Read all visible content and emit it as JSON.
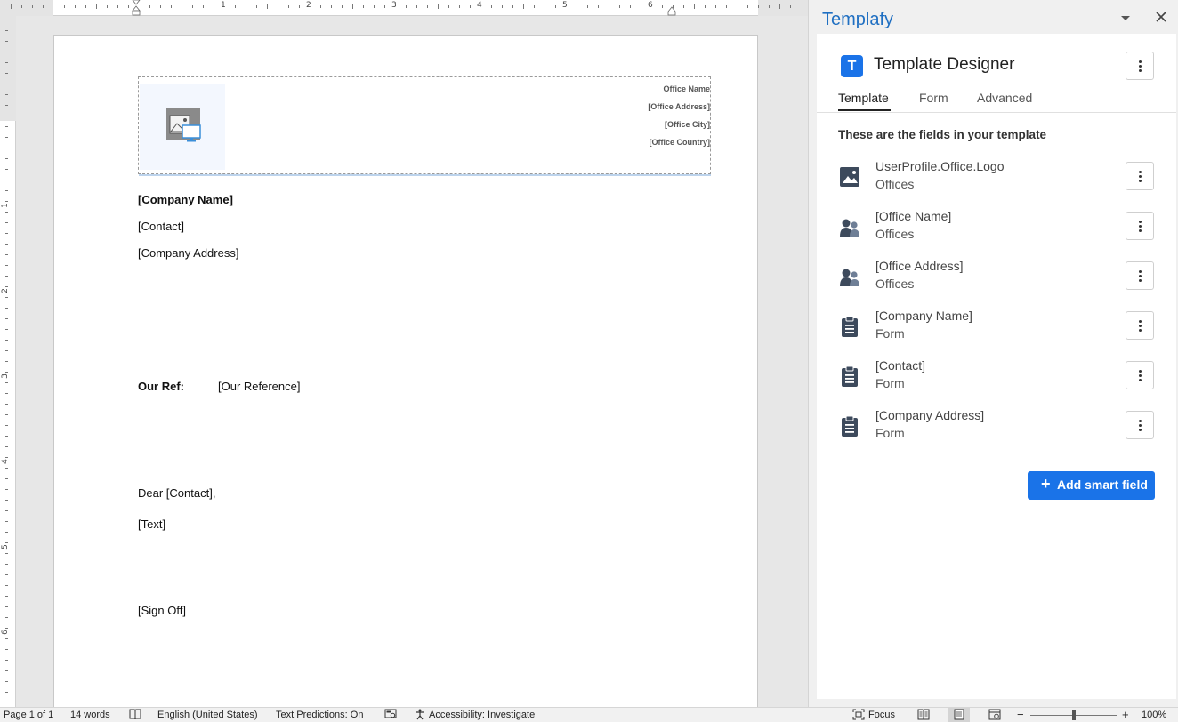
{
  "ruler": {
    "h_numbers": [
      "1",
      "2",
      "3",
      "4",
      "5",
      "6"
    ],
    "v_numbers": [
      "1",
      "2",
      "3",
      "4",
      "5",
      "6"
    ]
  },
  "document": {
    "header": {
      "office_name": "Office Name",
      "office_address": "[Office Address]",
      "office_city": "[Office City]",
      "office_country": "[Office Country]"
    },
    "company_name": "[Company Name]",
    "contact": "[Contact]",
    "company_address": "[Company Address]",
    "our_ref_label": "Our Ref:",
    "our_ref_value": "[Our Reference]",
    "salutation": "Dear [Contact],",
    "text": "[Text]",
    "sign_off": "[Sign Off]"
  },
  "statusbar": {
    "page": "Page 1 of 1",
    "words": "14 words",
    "language": "English (United States)",
    "text_predictions": "Text Predictions: On",
    "accessibility": "Accessibility: Investigate",
    "focus": "Focus",
    "zoom_minus": "−",
    "zoom_plus": "+",
    "zoom": "100%",
    "zoom_level": 0.5
  },
  "panel": {
    "title": "Templafy",
    "app_title": "Template Designer",
    "app_logo_letter": "T",
    "tabs": [
      {
        "label": "Template",
        "active": true
      },
      {
        "label": "Form",
        "active": false
      },
      {
        "label": "Advanced",
        "active": false
      }
    ],
    "fields_heading": "These are the fields in your template",
    "fields": [
      {
        "name": "UserProfile.Office.Logo",
        "source": "Offices",
        "icon": "image-icon"
      },
      {
        "name": "[Office Name]",
        "source": "Offices",
        "icon": "people-icon"
      },
      {
        "name": "[Office Address]",
        "source": "Offices",
        "icon": "people-icon"
      },
      {
        "name": "[Company Name]",
        "source": "Form",
        "icon": "clipboard-icon"
      },
      {
        "name": "[Contact]",
        "source": "Form",
        "icon": "clipboard-icon"
      },
      {
        "name": "[Company Address]",
        "source": "Form",
        "icon": "clipboard-icon"
      }
    ],
    "add_button": {
      "plus": "+",
      "label": "Add smart field"
    }
  },
  "colors": {
    "accent": "#1a73e8",
    "panel_title": "#1f6fc2",
    "icon_dark": "#3d4a5c"
  }
}
